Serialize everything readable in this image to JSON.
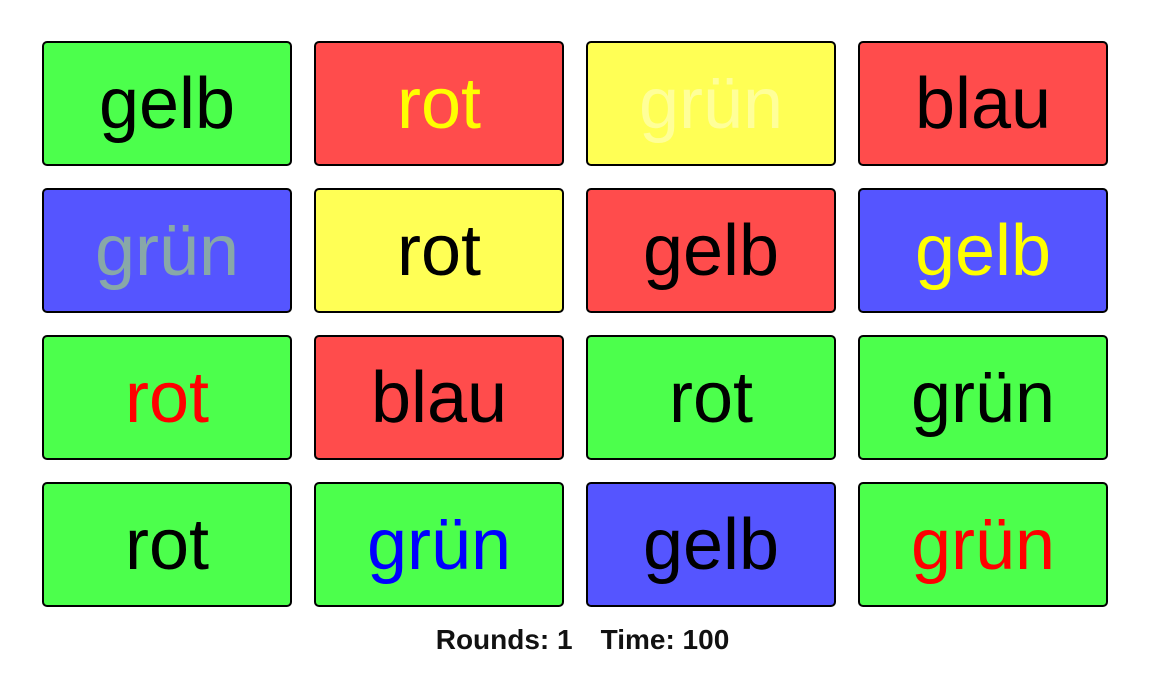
{
  "cards": [
    {
      "word": "gelb",
      "bg": "#4cff4c",
      "fg": "#000000"
    },
    {
      "word": "rot",
      "bg": "#ff4c4c",
      "fg": "#ffff00"
    },
    {
      "word": "grün",
      "bg": "#ffff55",
      "fg": "#ffff99"
    },
    {
      "word": "blau",
      "bg": "#ff4c4c",
      "fg": "#000000"
    },
    {
      "word": "grün",
      "bg": "#5555ff",
      "fg": "#88a8a8"
    },
    {
      "word": "rot",
      "bg": "#ffff55",
      "fg": "#000000"
    },
    {
      "word": "gelb",
      "bg": "#ff4c4c",
      "fg": "#000000"
    },
    {
      "word": "gelb",
      "bg": "#5555ff",
      "fg": "#ffff00"
    },
    {
      "word": "rot",
      "bg": "#4cff4c",
      "fg": "#ff0000"
    },
    {
      "word": "blau",
      "bg": "#ff4c4c",
      "fg": "#000000"
    },
    {
      "word": "rot",
      "bg": "#4cff4c",
      "fg": "#000000"
    },
    {
      "word": "grün",
      "bg": "#4cff4c",
      "fg": "#000000"
    },
    {
      "word": "rot",
      "bg": "#4cff4c",
      "fg": "#000000"
    },
    {
      "word": "grün",
      "bg": "#4cff4c",
      "fg": "#0000ff"
    },
    {
      "word": "gelb",
      "bg": "#5555ff",
      "fg": "#000000"
    },
    {
      "word": "grün",
      "bg": "#4cff4c",
      "fg": "#ff0000"
    }
  ],
  "status": {
    "rounds_label": "Rounds: 1",
    "time_label": "Time: 100"
  }
}
